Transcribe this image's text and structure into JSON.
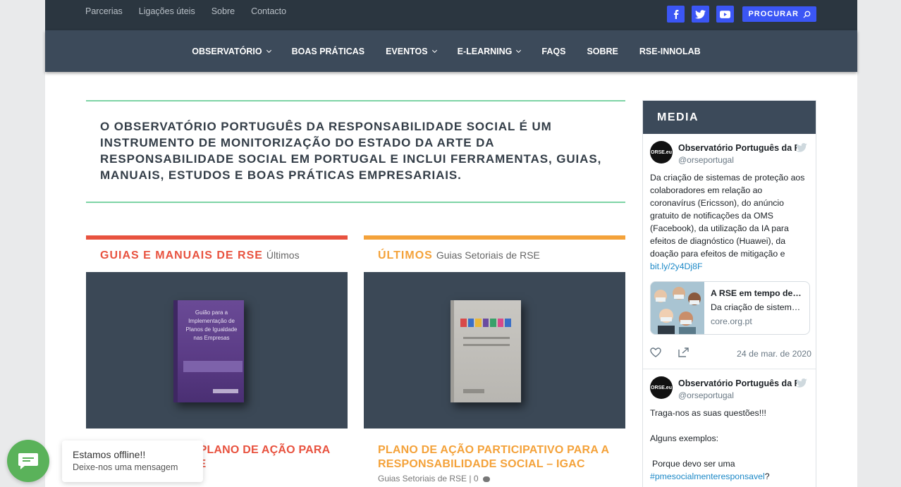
{
  "topbar": {
    "links": [
      "Parcerias",
      "Ligações úteis",
      "Sobre",
      "Contacto"
    ],
    "social_icons": [
      "facebook-icon",
      "twitter-icon",
      "youtube-icon"
    ],
    "search_label": "PROCURAR",
    "accent_color": "#3b56f5"
  },
  "nav": {
    "items": [
      {
        "label": "OBSERVATÓRIO",
        "has_dropdown": true
      },
      {
        "label": "BOAS PRÁTICAS",
        "has_dropdown": false
      },
      {
        "label": "EVENTOS",
        "has_dropdown": true
      },
      {
        "label": "E-LEARNING",
        "has_dropdown": true
      },
      {
        "label": "FAQS",
        "has_dropdown": false
      },
      {
        "label": "SOBRE",
        "has_dropdown": false
      },
      {
        "label": "RSE-INNOLAB",
        "has_dropdown": false
      }
    ]
  },
  "intro": {
    "text": "O OBSERVATÓRIO PORTUGUÊS DA RESPONSABILIDADE SOCIAL É UM INSTRUMENTO DE MONITORIZAÇÃO DO ESTADO DA ARTE DA RESPONSABILIDADE SOCIAL EM PORTUGAL E INCLUI FERRAMENTAS, GUIAS, MANUAIS, ESTUDOS E BOAS PRÁTICAS EMPRESARIAIS.",
    "border_color": "#7ed4a6"
  },
  "cards": [
    {
      "title": "GUIAS E MANUAIS DE RSE",
      "subtitle": "Últimos",
      "accent": "#e8523f",
      "book_text": "Guião para a Implementação de Planos de Igualdade nas Empresas",
      "post_title": "…NCIA PARA A …PLANO DE AÇÃO PARA …RE MULHERES E",
      "meta": ""
    },
    {
      "title": "ÚLTIMOS",
      "subtitle": "Guias Setoriais de RSE",
      "accent": "#f4a23a",
      "book_text": "",
      "post_title": "PLANO DE AÇÃO PARTICIPATIVO PARA A RESPONSABILIDADE SOCIAL – IGAC",
      "meta": "Guias Setoriais de RSE | 0"
    }
  ],
  "media": {
    "title": "MEDIA",
    "tweets": [
      {
        "avatar": "ORSE.eu",
        "name": "Observatório Português da Re",
        "handle": "@orseportugal",
        "text": "Da criação de sistemas de proteção aos colaboradores em relação ao coronavírus (Ericsson), do anúncio gratuito de notificações da OMS (Facebook), da utilização da IA para efeitos de diagnóstico (Huawei), da doação para efeitos de mitigação e",
        "link": "bit.ly/2y4Dj8F",
        "card_title": "A RSE em tempo de …",
        "card_desc": "Da criação de sistem…",
        "card_domain": "core.org.pt",
        "date": "24 de mar. de 2020"
      },
      {
        "avatar": "ORSE.eu",
        "name": "Observatório Português da Re",
        "handle": "@orseportugal",
        "line1": "Traga-nos as suas questões!!!",
        "line2": "Alguns exemplos:",
        "line3": "Porque devo ser uma",
        "hashtag": "#pmesocialmenteresponsavel",
        "qmark": "?"
      }
    ]
  },
  "chat": {
    "status": "Estamos offline!!",
    "prompt": "Deixe-nos uma mensagem",
    "color": "#5ab25a"
  }
}
